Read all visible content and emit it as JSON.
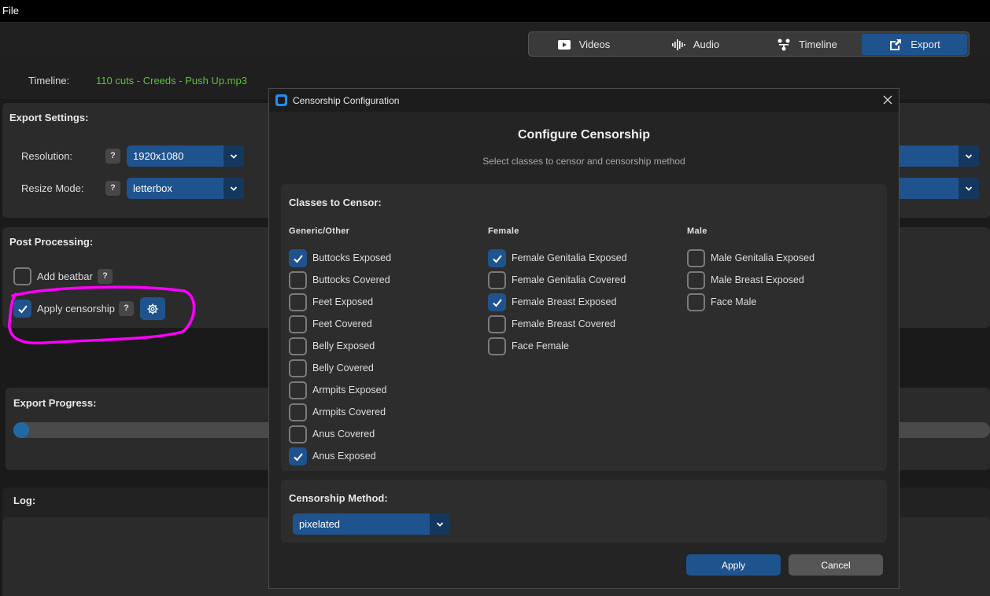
{
  "menu": {
    "file": "File"
  },
  "tabs": [
    {
      "label": "Videos",
      "icon": "video-icon",
      "active": false
    },
    {
      "label": "Audio",
      "icon": "audio-wave-icon",
      "active": false
    },
    {
      "label": "Timeline",
      "icon": "timeline-icon",
      "active": false
    },
    {
      "label": "Export",
      "icon": "export-icon",
      "active": true
    }
  ],
  "timeline": {
    "label": "Timeline:",
    "value": "110 cuts - Creeds - Push Up.mp3"
  },
  "export_settings": {
    "title": "Export Settings:",
    "resolution_label": "Resolution:",
    "resolution_value": "1920x1080",
    "resize_label": "Resize Mode:",
    "resize_value": "letterbox",
    "help": "?"
  },
  "post_processing": {
    "title": "Post Processing:",
    "beatbar_label": "Add beatbar",
    "beatbar_checked": false,
    "censorship_label": "Apply censorship",
    "censorship_checked": true,
    "help": "?"
  },
  "export_progress": {
    "title": "Export Progress:",
    "progress": 0.0
  },
  "log": {
    "title": "Log:"
  },
  "dialog": {
    "window_title": "Censorship Configuration",
    "heading": "Configure Censorship",
    "subtitle": "Select classes to censor and censorship method",
    "classes_title": "Classes to Censor:",
    "columns": [
      {
        "header": "Generic/Other",
        "items": [
          {
            "label": "Buttocks Exposed",
            "checked": true
          },
          {
            "label": "Buttocks Covered",
            "checked": false
          },
          {
            "label": "Feet Exposed",
            "checked": false
          },
          {
            "label": "Feet Covered",
            "checked": false
          },
          {
            "label": "Belly Exposed",
            "checked": false
          },
          {
            "label": "Belly Covered",
            "checked": false
          },
          {
            "label": "Armpits Exposed",
            "checked": false
          },
          {
            "label": "Armpits Covered",
            "checked": false
          },
          {
            "label": "Anus Covered",
            "checked": false
          },
          {
            "label": "Anus Exposed",
            "checked": true
          }
        ]
      },
      {
        "header": "Female",
        "items": [
          {
            "label": "Female Genitalia Exposed",
            "checked": true
          },
          {
            "label": "Female Genitalia Covered",
            "checked": false
          },
          {
            "label": "Female Breast Exposed",
            "checked": true
          },
          {
            "label": "Female Breast Covered",
            "checked": false
          },
          {
            "label": "Face Female",
            "checked": false
          }
        ]
      },
      {
        "header": "Male",
        "items": [
          {
            "label": "Male Genitalia Exposed",
            "checked": false
          },
          {
            "label": "Male Breast Exposed",
            "checked": false
          },
          {
            "label": "Face Male",
            "checked": false
          }
        ]
      }
    ],
    "method_title": "Censorship Method:",
    "method_value": "pixelated",
    "apply_label": "Apply",
    "cancel_label": "Cancel"
  },
  "colors": {
    "accent": "#1f538d",
    "accent_dark": "#14375e",
    "highlight": "#ff00ff",
    "timeline_value": "#5fbf3f"
  }
}
